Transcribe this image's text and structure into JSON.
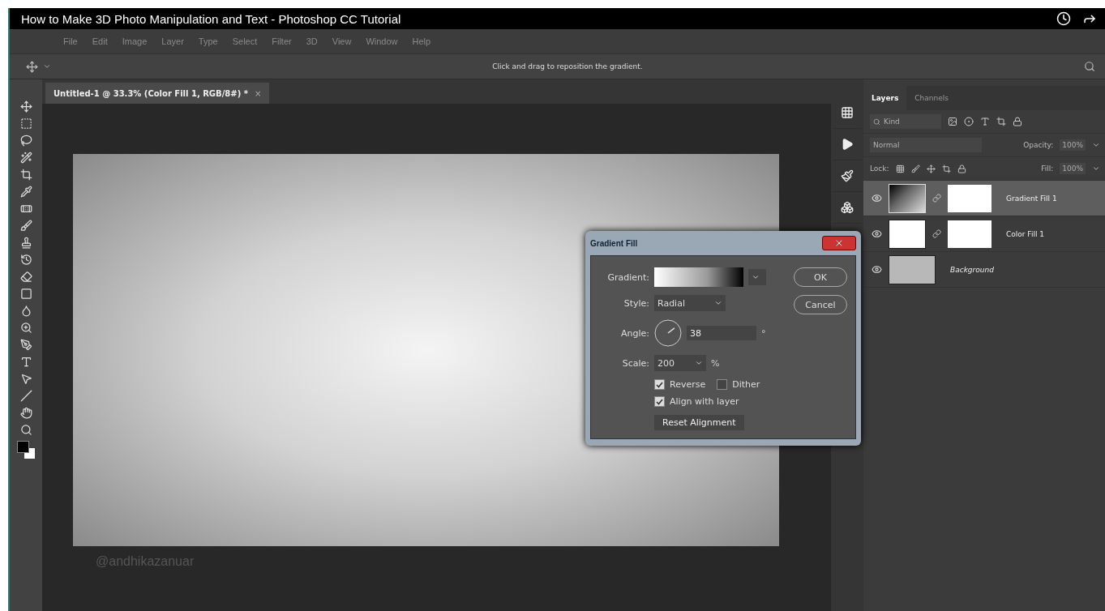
{
  "video": {
    "title": "How to Make 3D Photo Manipulation and Text - Photoshop CC Tutorial",
    "channel_handle": "@andhikazanuar"
  },
  "menu": [
    "File",
    "Edit",
    "Image",
    "Layer",
    "Type",
    "Select",
    "Filter",
    "3D",
    "View",
    "Window",
    "Help"
  ],
  "options_bar": {
    "hint": "Click and drag to reposition the gradient."
  },
  "document_tab": {
    "label": "Untitled-1 @ 33.3% (Color Fill 1, RGB/8#) *",
    "close": "×"
  },
  "dialog": {
    "title": "Gradient Fill",
    "gradient_label": "Gradient:",
    "style_label": "Style:",
    "style": "Radial",
    "angle_label": "Angle:",
    "angle": "38",
    "degree": "°",
    "scale_label": "Scale:",
    "scale": "200",
    "percent": "%",
    "checkboxes": [
      {
        "label": "Reverse",
        "checked": true
      },
      {
        "label": "Dither",
        "checked": false
      },
      {
        "label": "Align with layer",
        "checked": true
      }
    ],
    "reset": "Reset Alignment",
    "buttons": [
      "OK",
      "Cancel"
    ]
  },
  "layers_panel": {
    "tabs": [
      {
        "label": "Layers",
        "selected": true
      },
      {
        "label": "Channels",
        "selected": false
      }
    ],
    "filter_placeholder": "Kind",
    "blend_mode": "Normal",
    "opacity_label": "Opacity:",
    "opacity": "100%",
    "lock_label": "Lock:",
    "fill_label": "Fill:",
    "fill": "100%",
    "layers": [
      {
        "name": "Gradient Fill 1",
        "kind": "gradient",
        "selected": true
      },
      {
        "name": "Color Fill 1",
        "kind": "color",
        "selected": false
      },
      {
        "name": "Background",
        "kind": "background",
        "selected": false
      }
    ]
  }
}
